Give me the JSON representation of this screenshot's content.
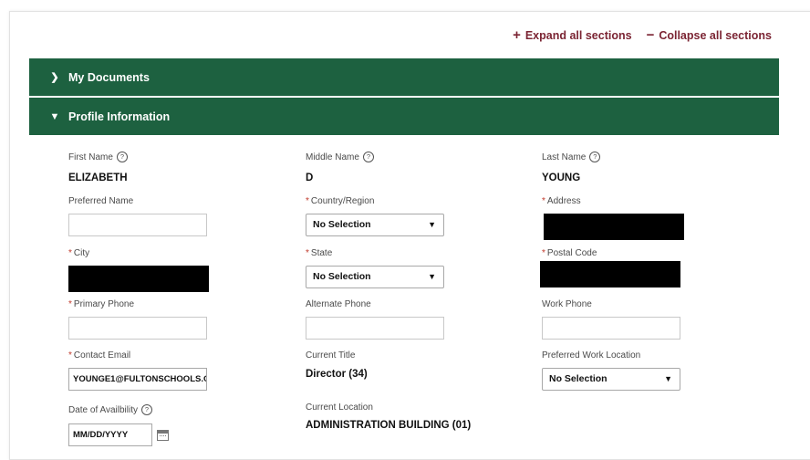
{
  "toolbar": {
    "expand_label": "Expand all sections",
    "collapse_label": "Collapse all sections"
  },
  "sections": {
    "documents": "My Documents",
    "profile": "Profile Information"
  },
  "icons": {
    "expand": "plus-icon",
    "collapse": "minus-icon",
    "collapsed": "chevron-right-icon",
    "expanded": "chevron-down-icon",
    "help": "help-circle-icon",
    "calendar": "calendar-icon"
  },
  "colors": {
    "header_bg": "#1d6140",
    "accent_link": "#7b2433",
    "required_marker": "#c0392b"
  },
  "profile": {
    "first_name": {
      "label": "First Name",
      "value": "ELIZABETH"
    },
    "middle_name": {
      "label": "Middle Name",
      "value": "D"
    },
    "last_name": {
      "label": "Last Name",
      "value": "YOUNG"
    },
    "preferred_name": {
      "label": "Preferred Name",
      "value": ""
    },
    "country_region": {
      "label": "Country/Region",
      "value": "No Selection"
    },
    "address": {
      "label": "Address",
      "redacted": true
    },
    "city": {
      "label": "City",
      "redacted": true
    },
    "state": {
      "label": "State",
      "value": "No Selection"
    },
    "postal_code": {
      "label": "Postal Code",
      "redacted": true
    },
    "primary_phone": {
      "label": "Primary Phone",
      "value": ""
    },
    "alternate_phone": {
      "label": "Alternate Phone",
      "value": ""
    },
    "work_phone": {
      "label": "Work Phone",
      "value": ""
    },
    "contact_email": {
      "label": "Contact Email",
      "value": "YOUNGE1@FULTONSCHOOLS.O"
    },
    "current_title": {
      "label": "Current Title",
      "value": "Director (34)"
    },
    "preferred_work_location": {
      "label": "Preferred Work Location",
      "value": "No Selection"
    },
    "date_of_availability": {
      "label": "Date of Availbility",
      "value": "MM/DD/YYYY"
    },
    "current_location": {
      "label": "Current Location",
      "value": "ADMINISTRATION BUILDING (01)"
    }
  }
}
